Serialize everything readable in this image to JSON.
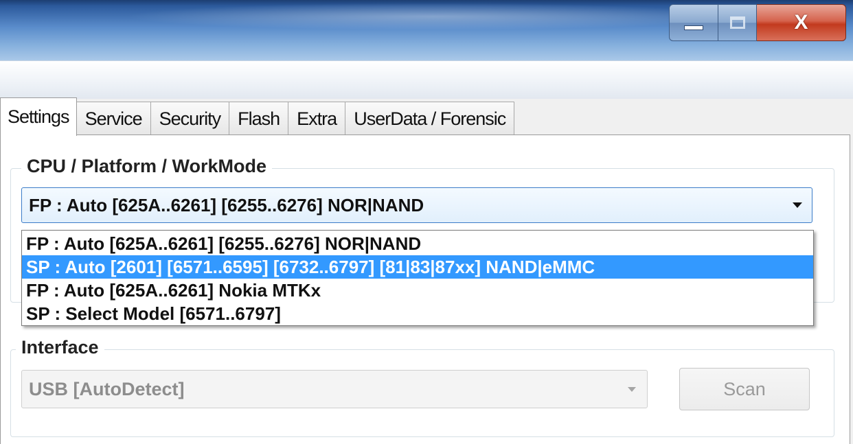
{
  "window": {
    "caption_buttons": {
      "minimize_icon": "minimize-icon",
      "maximize_icon": "maximize-icon",
      "close_icon": "close-icon",
      "close_glyph": "X"
    }
  },
  "tabs": [
    {
      "label": "Settings",
      "active": true
    },
    {
      "label": "Service",
      "active": false
    },
    {
      "label": "Security",
      "active": false
    },
    {
      "label": "Flash",
      "active": false
    },
    {
      "label": "Extra",
      "active": false
    },
    {
      "label": "UserData / Forensic",
      "active": false
    }
  ],
  "cpu_group": {
    "title": "CPU / Platform / WorkMode",
    "selected_value": "FP : Auto [625A..6261] [6255..6276] NOR|NAND",
    "options": [
      "FP : Auto [625A..6261] [6255..6276] NOR|NAND",
      "SP : Auto [2601] [6571..6595] [6732..6797] [81|83|87xx]  NAND|eMMC",
      "FP : Auto [625A..6261] Nokia MTKx",
      "SP : Select Model [6571..6797]"
    ],
    "highlighted_index": 1
  },
  "interface_group": {
    "title": "Interface",
    "selected_value": "USB [AutoDetect]",
    "scan_label": "Scan",
    "disabled": true
  },
  "colors": {
    "highlight": "#3399ff",
    "combo_border": "#3b7cc8",
    "close_button": "#c23a1e"
  }
}
